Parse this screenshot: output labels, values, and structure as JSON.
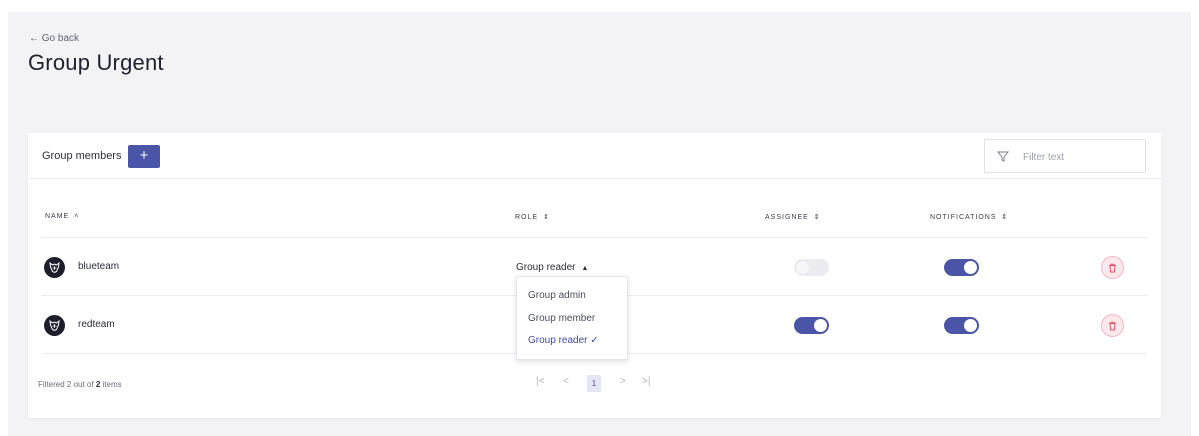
{
  "header": {
    "back_label": "← Go back",
    "title": "Group Urgent"
  },
  "members_section": {
    "title": "Group members",
    "add_label": "+",
    "filter_placeholder": "Filter text"
  },
  "table": {
    "columns": [
      {
        "label": "NAME",
        "sort": "˄"
      },
      {
        "label": "ROLE",
        "sort": "⇕"
      },
      {
        "label": "ASSIGNEE",
        "sort": "⇕"
      },
      {
        "label": "NOTIFICATIONS",
        "sort": "⇕"
      }
    ],
    "rows": [
      {
        "name": "blueteam",
        "role": "Group reader",
        "role_caret": "▲",
        "assignee": false,
        "notifications": true
      },
      {
        "name": "redteam",
        "role": "Group reader",
        "assignee": true,
        "notifications": true
      }
    ]
  },
  "role_dropdown": {
    "options": [
      "Group admin",
      "Group member",
      "Group reader"
    ],
    "selected": "Group reader",
    "check": "✓"
  },
  "footer": {
    "count_prefix": "Filtered 2 out of",
    "count_total": "2",
    "count_suffix": "items",
    "pagination": {
      "first": "|<",
      "prev": "<",
      "current": "1",
      "next": ">",
      "last": ">|"
    }
  },
  "colors": {
    "accent": "#4a55a8",
    "toggle_off": "#ececf0",
    "danger": "#e0526a"
  },
  "icons": {
    "filter": "filter-icon",
    "avatar": "wolf-logo-icon",
    "delete": "trash-icon"
  }
}
